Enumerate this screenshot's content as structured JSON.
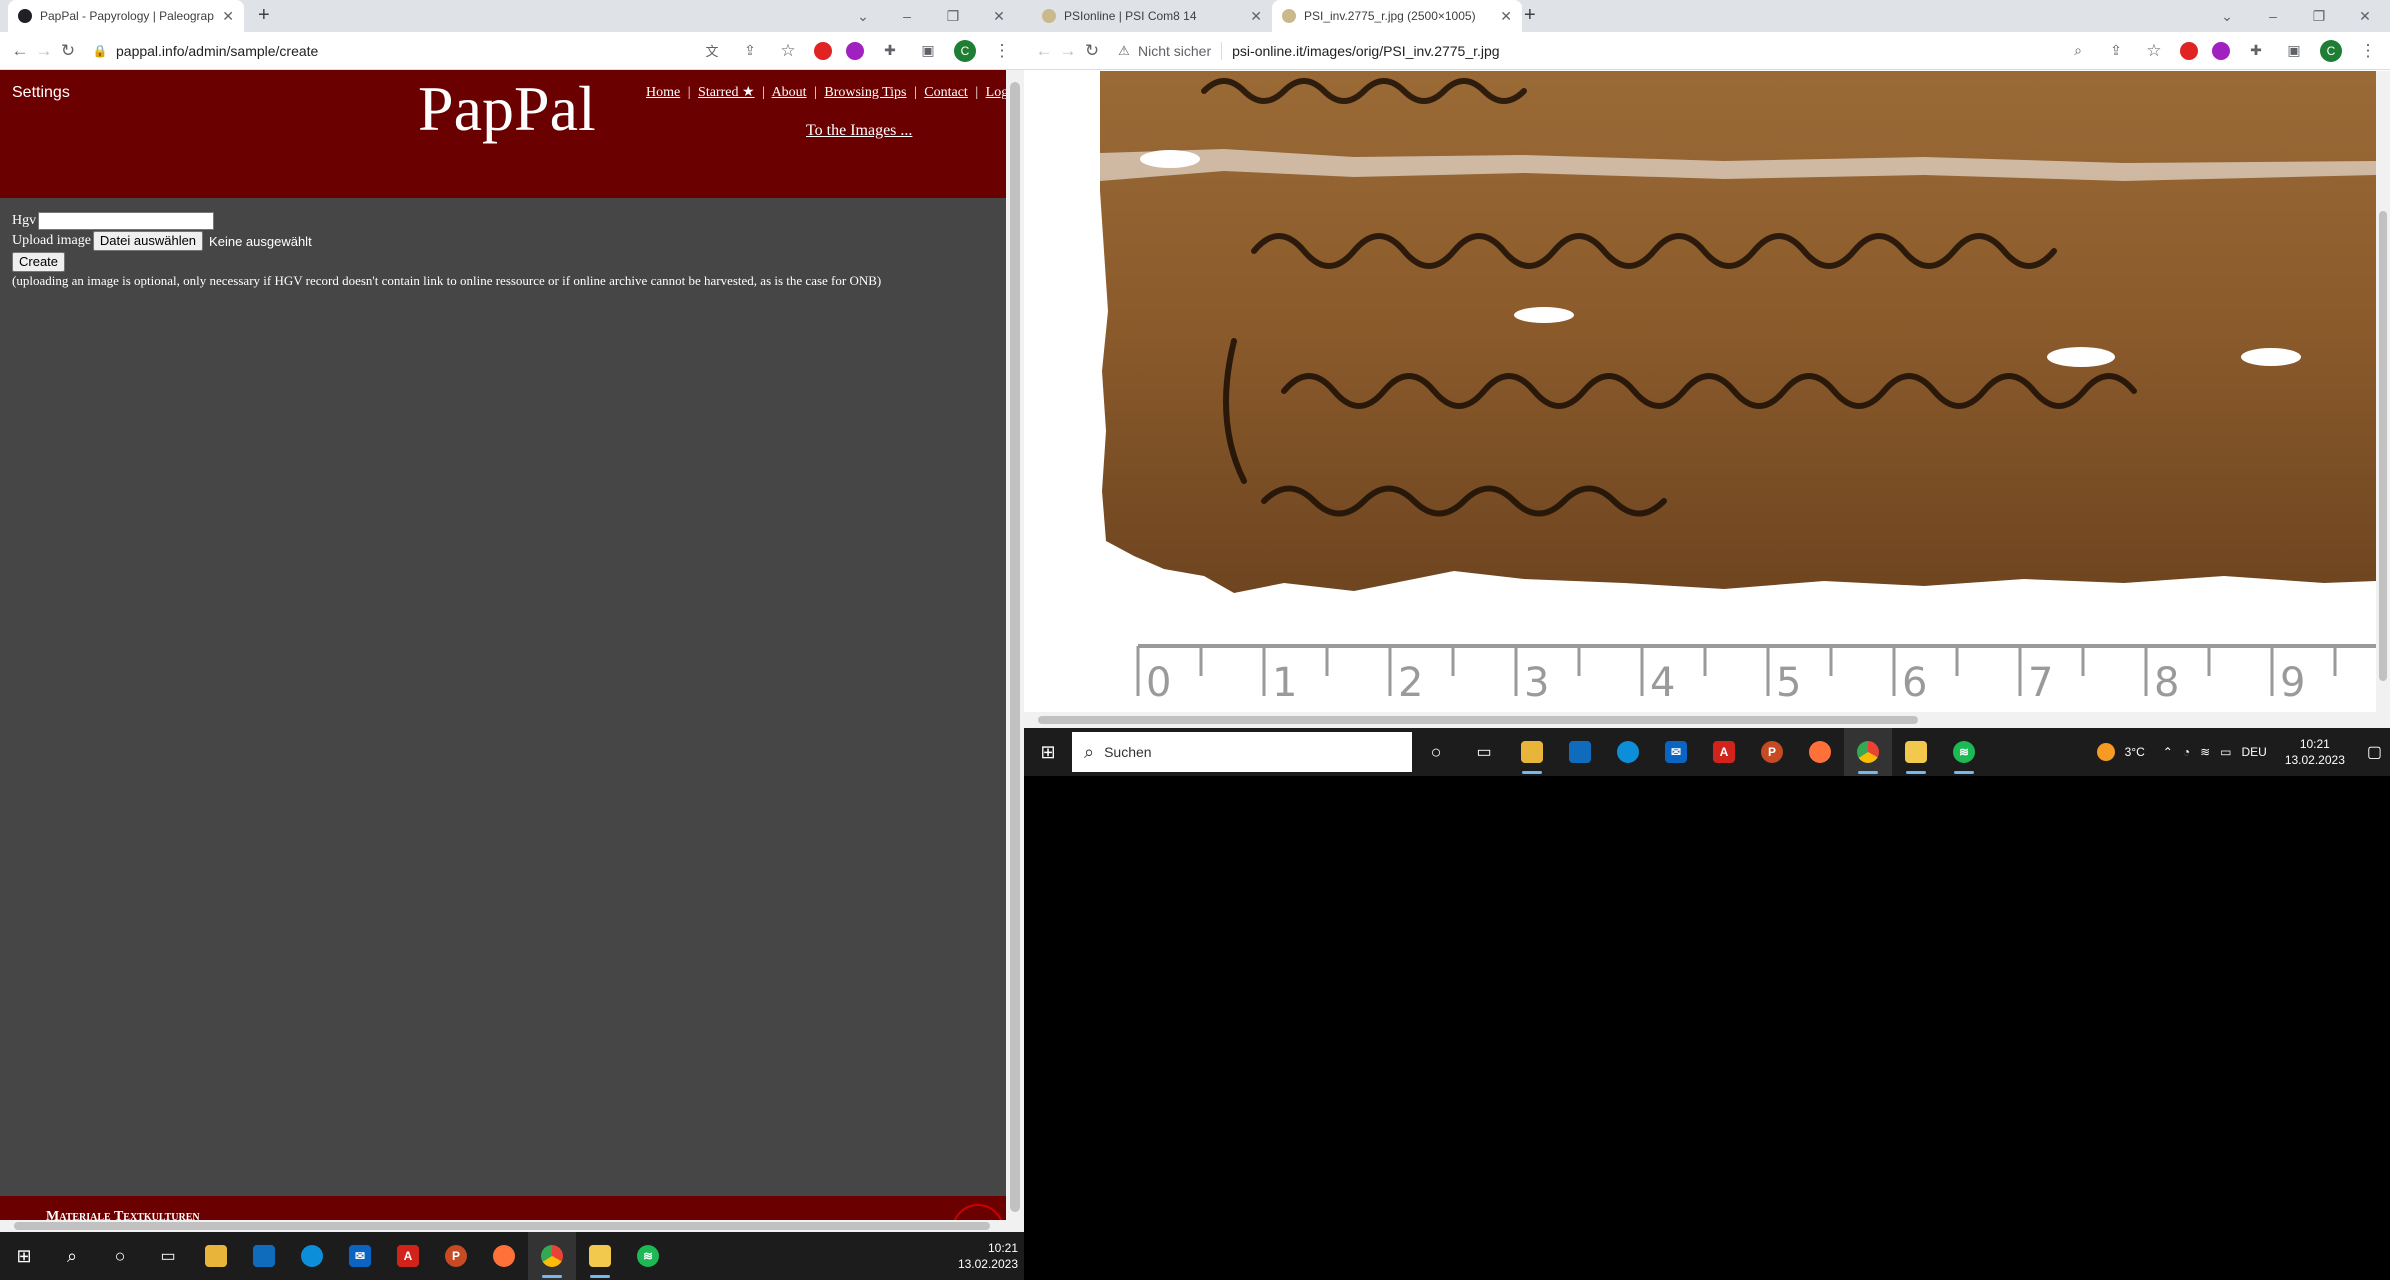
{
  "left_window": {
    "tabs": [
      {
        "title": "PapPal - Papyrology | Paleograph"
      }
    ],
    "new_tab": "+",
    "url": "pappal.info/admin/sample/create",
    "page": {
      "settings_label": "Settings",
      "logo": "PapPal",
      "nav": [
        "Home",
        "Starred ★",
        "About",
        "Browsing Tips",
        "Contact",
        "Logout"
      ],
      "separator": "|",
      "to_images": "To the Images ...",
      "hgv_label": "Hgv",
      "hgv_value": "",
      "upload_label": "Upload image",
      "file_button": "Datei auswählen",
      "file_status": "Keine ausgewählt",
      "create_button": "Create",
      "note": "(uploading an image is optional, only necessary if HGV record doesn't contain link to online ressource or if online archive cannot be harvested, as is the case for ONB)",
      "footer_text": "Materiale Textkulturen"
    }
  },
  "right_window": {
    "tabs": [
      {
        "title": "PSIonline | PSI Com8 14"
      },
      {
        "title": "PSI_inv.2775_r.jpg (2500×1005)"
      }
    ],
    "new_tab": "+",
    "security": "Nicht sicher",
    "url": "psi-online.it/images/orig/PSI_inv.2775_r.jpg",
    "ruler_numbers": [
      "0",
      "1",
      "2",
      "3",
      "4",
      "5",
      "6",
      "7",
      "8",
      "9"
    ],
    "papyrus_level": 0.66
  },
  "right_taskbar": {
    "search_placeholder": "Suchen",
    "weather": "3°C",
    "lang": "DEU",
    "time": "10:21",
    "date": "13.02.2023"
  },
  "main_taskbar": {
    "time": "10:21",
    "date": "13.02.2023"
  },
  "colors": {
    "header_red": "#6b0000",
    "body_gray": "#464646",
    "papyrus": "#8a5a2b"
  }
}
